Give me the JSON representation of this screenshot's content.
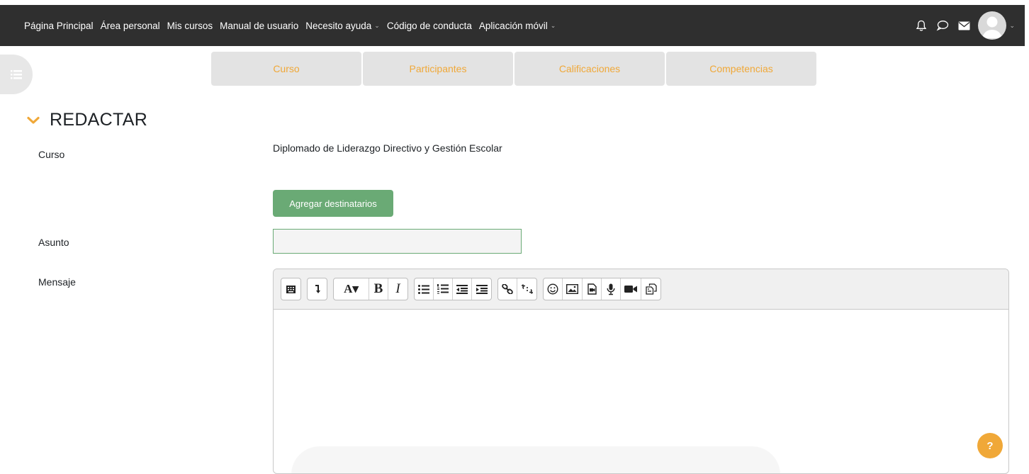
{
  "navbar": {
    "items": [
      {
        "label": "Página Principal",
        "dropdown": false
      },
      {
        "label": "Área personal",
        "dropdown": false
      },
      {
        "label": "Mis cursos",
        "dropdown": false
      },
      {
        "label": "Manual de usuario",
        "dropdown": false
      },
      {
        "label": "Necesito ayuda",
        "dropdown": true
      },
      {
        "label": "Código de conducta",
        "dropdown": false
      },
      {
        "label": "Aplicación móvil",
        "dropdown": true
      }
    ],
    "icons": [
      "bell-icon",
      "chat-icon",
      "envelope-icon",
      "user-avatar"
    ]
  },
  "tabs": [
    "Curso",
    "Participantes",
    "Calificaciones",
    "Competencias"
  ],
  "page": {
    "section_title": "REDACTAR",
    "course_label": "Curso",
    "course_value": "Diplomado de Liderazgo Directivo y Gestión Escolar",
    "add_recipients_button": "Agregar destinatarios",
    "subject_label": "Asunto",
    "subject_value": "",
    "message_label": "Mensaje",
    "help_button": "?"
  },
  "editor": {
    "toolbar_groups": [
      [
        "toolbar-toggle-icon"
      ],
      [
        "redo-arrow-icon"
      ],
      [
        "font-style-icon",
        "bold-icon",
        "italic-icon"
      ],
      [
        "bullet-list-icon",
        "numbered-list-icon",
        "outdent-icon",
        "indent-icon"
      ],
      [
        "link-icon",
        "unlink-icon"
      ],
      [
        "emoji-icon",
        "image-icon",
        "media-icon",
        "microphone-icon",
        "video-icon",
        "copy-icon"
      ]
    ],
    "text_buttons": {
      "font": "A▾",
      "bold": "B",
      "italic": "I"
    }
  },
  "colors": {
    "navbar_bg": "#2f2f2f",
    "tab_text": "#f0a838",
    "accent_orange": "#f0a838",
    "button_green": "#6aaa75"
  }
}
